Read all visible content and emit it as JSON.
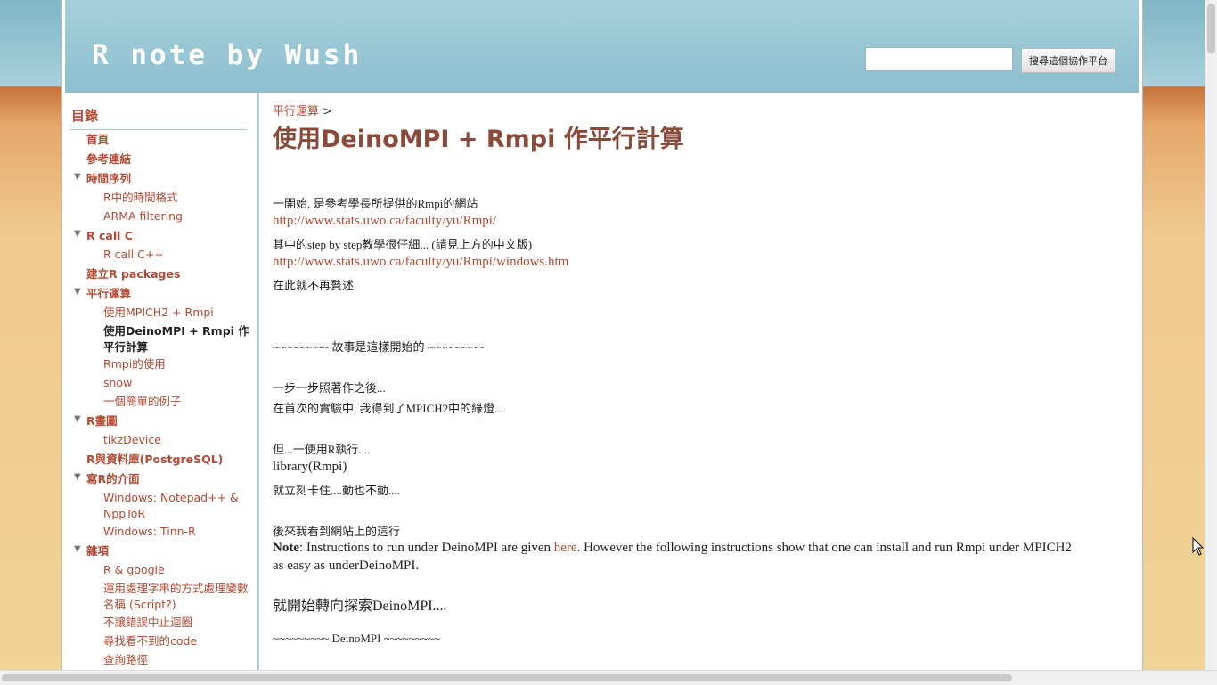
{
  "header": {
    "site_title": "R note by Wush",
    "search_placeholder": "",
    "search_button_label": "搜尋這個協作平台"
  },
  "sidebar": {
    "title": "目錄",
    "items": [
      {
        "label": "首頁",
        "level": 1
      },
      {
        "label": "參考連結",
        "level": 1
      },
      {
        "label": "時間序列",
        "level": 1,
        "expanded": true
      },
      {
        "label": "R中的時間格式",
        "level": 2
      },
      {
        "label": "ARMA filtering",
        "level": 2
      },
      {
        "label": "R call C",
        "level": 1,
        "expanded": true
      },
      {
        "label": "R call C++",
        "level": 2
      },
      {
        "label": "建立R packages",
        "level": 1
      },
      {
        "label": "平行運算",
        "level": 1,
        "expanded": true
      },
      {
        "label": "使用MPICH2 + Rmpi",
        "level": 2
      },
      {
        "label": "使用DeinoMPI + Rmpi 作平行計算",
        "level": 2,
        "current": true
      },
      {
        "label": "Rmpi的使用",
        "level": 2
      },
      {
        "label": "snow",
        "level": 2
      },
      {
        "label": "一個簡單的例子",
        "level": 2
      },
      {
        "label": "R畫圖",
        "level": 1,
        "expanded": true
      },
      {
        "label": "tikzDevice",
        "level": 2
      },
      {
        "label": "R與資料庫(PostgreSQL)",
        "level": 1
      },
      {
        "label": "寫R的介面",
        "level": 1,
        "expanded": true
      },
      {
        "label": "Windows: Notepad++ & NppToR",
        "level": 2
      },
      {
        "label": "Windows: Tinn-R",
        "level": 2
      },
      {
        "label": "雜項",
        "level": 1,
        "expanded": true
      },
      {
        "label": "R & google",
        "level": 2
      },
      {
        "label": "運用處理字串的方式處理變數名稱 (Script?)",
        "level": 2
      },
      {
        "label": "不讓錯誤中止迴圈",
        "level": 2
      },
      {
        "label": "尋找看不到的code",
        "level": 2
      },
      {
        "label": "查詢路徑",
        "level": 2
      }
    ]
  },
  "content": {
    "breadcrumb_link": "平行運算",
    "breadcrumb_sep": ">",
    "title": "使用DeinoMPI + Rmpi 作平行計算",
    "p1": "一開始, 是參考學長所提供的Rmpi的網站",
    "link1": "http://www.stats.uwo.ca/faculty/yu/Rmpi/",
    "p2": "其中的step by step教學很仔細... (請見上方的中文版)",
    "link2": "http://www.stats.uwo.ca/faculty/yu/Rmpi/windows.htm",
    "p3": "在此就不再贅述",
    "story_heading": "~~~~~~~~~ 故事是這樣開始的 ~~~~~~~~~",
    "p4": "一步一步照著作之後...",
    "p5": "在首次的實驗中, 我得到了MPICH2中的綠燈...",
    "p6": "但...一使用R執行....",
    "code1": "library(Rmpi)",
    "p7": "就立刻卡住....動也不動....",
    "p8": "後來我看到網站上的這行",
    "note_bold": "Note",
    "note_text1": ": Instructions to run under DeinoMPI are given ",
    "note_link": "here",
    "note_text2": ". However the following instructions show that one can install and run Rmpi under MPICH2",
    "note_text3": "as easy as underDeinoMPI.",
    "p9": "就開始轉向探索DeinoMPI....",
    "deino_heading": "~~~~~~~~~ DeinoMPI ~~~~~~~~~"
  }
}
